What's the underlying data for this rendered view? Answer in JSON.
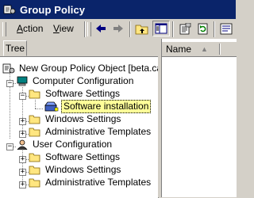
{
  "window": {
    "title": "Group Policy",
    "accent": "#0a246a",
    "icon": "group-policy-icon"
  },
  "menu": [
    {
      "label": "Action",
      "accel": "A",
      "rest": "ction"
    },
    {
      "label": "View",
      "accel": "V",
      "rest": "iew"
    }
  ],
  "toolbar_icons": [
    "back-arrow-icon",
    "forward-arrow-icon",
    "up-folder-icon",
    "show-hide-tree-icon",
    "properties-icon",
    "refresh-icon",
    "help-icon"
  ],
  "tabs": {
    "tree": "Tree"
  },
  "list": {
    "column_name": "Name",
    "sort_indicator": "▲"
  },
  "tree": {
    "root": "New Group Policy Object [beta.care",
    "computer": "Computer Configuration",
    "comp_software": "Software Settings",
    "software_installation": "Software installation",
    "comp_windows": "Windows Settings",
    "comp_admin": "Administrative Templates",
    "user": "User Configuration",
    "user_software": "Software Settings",
    "user_windows": "Windows Settings",
    "user_admin": "Administrative Templates"
  }
}
